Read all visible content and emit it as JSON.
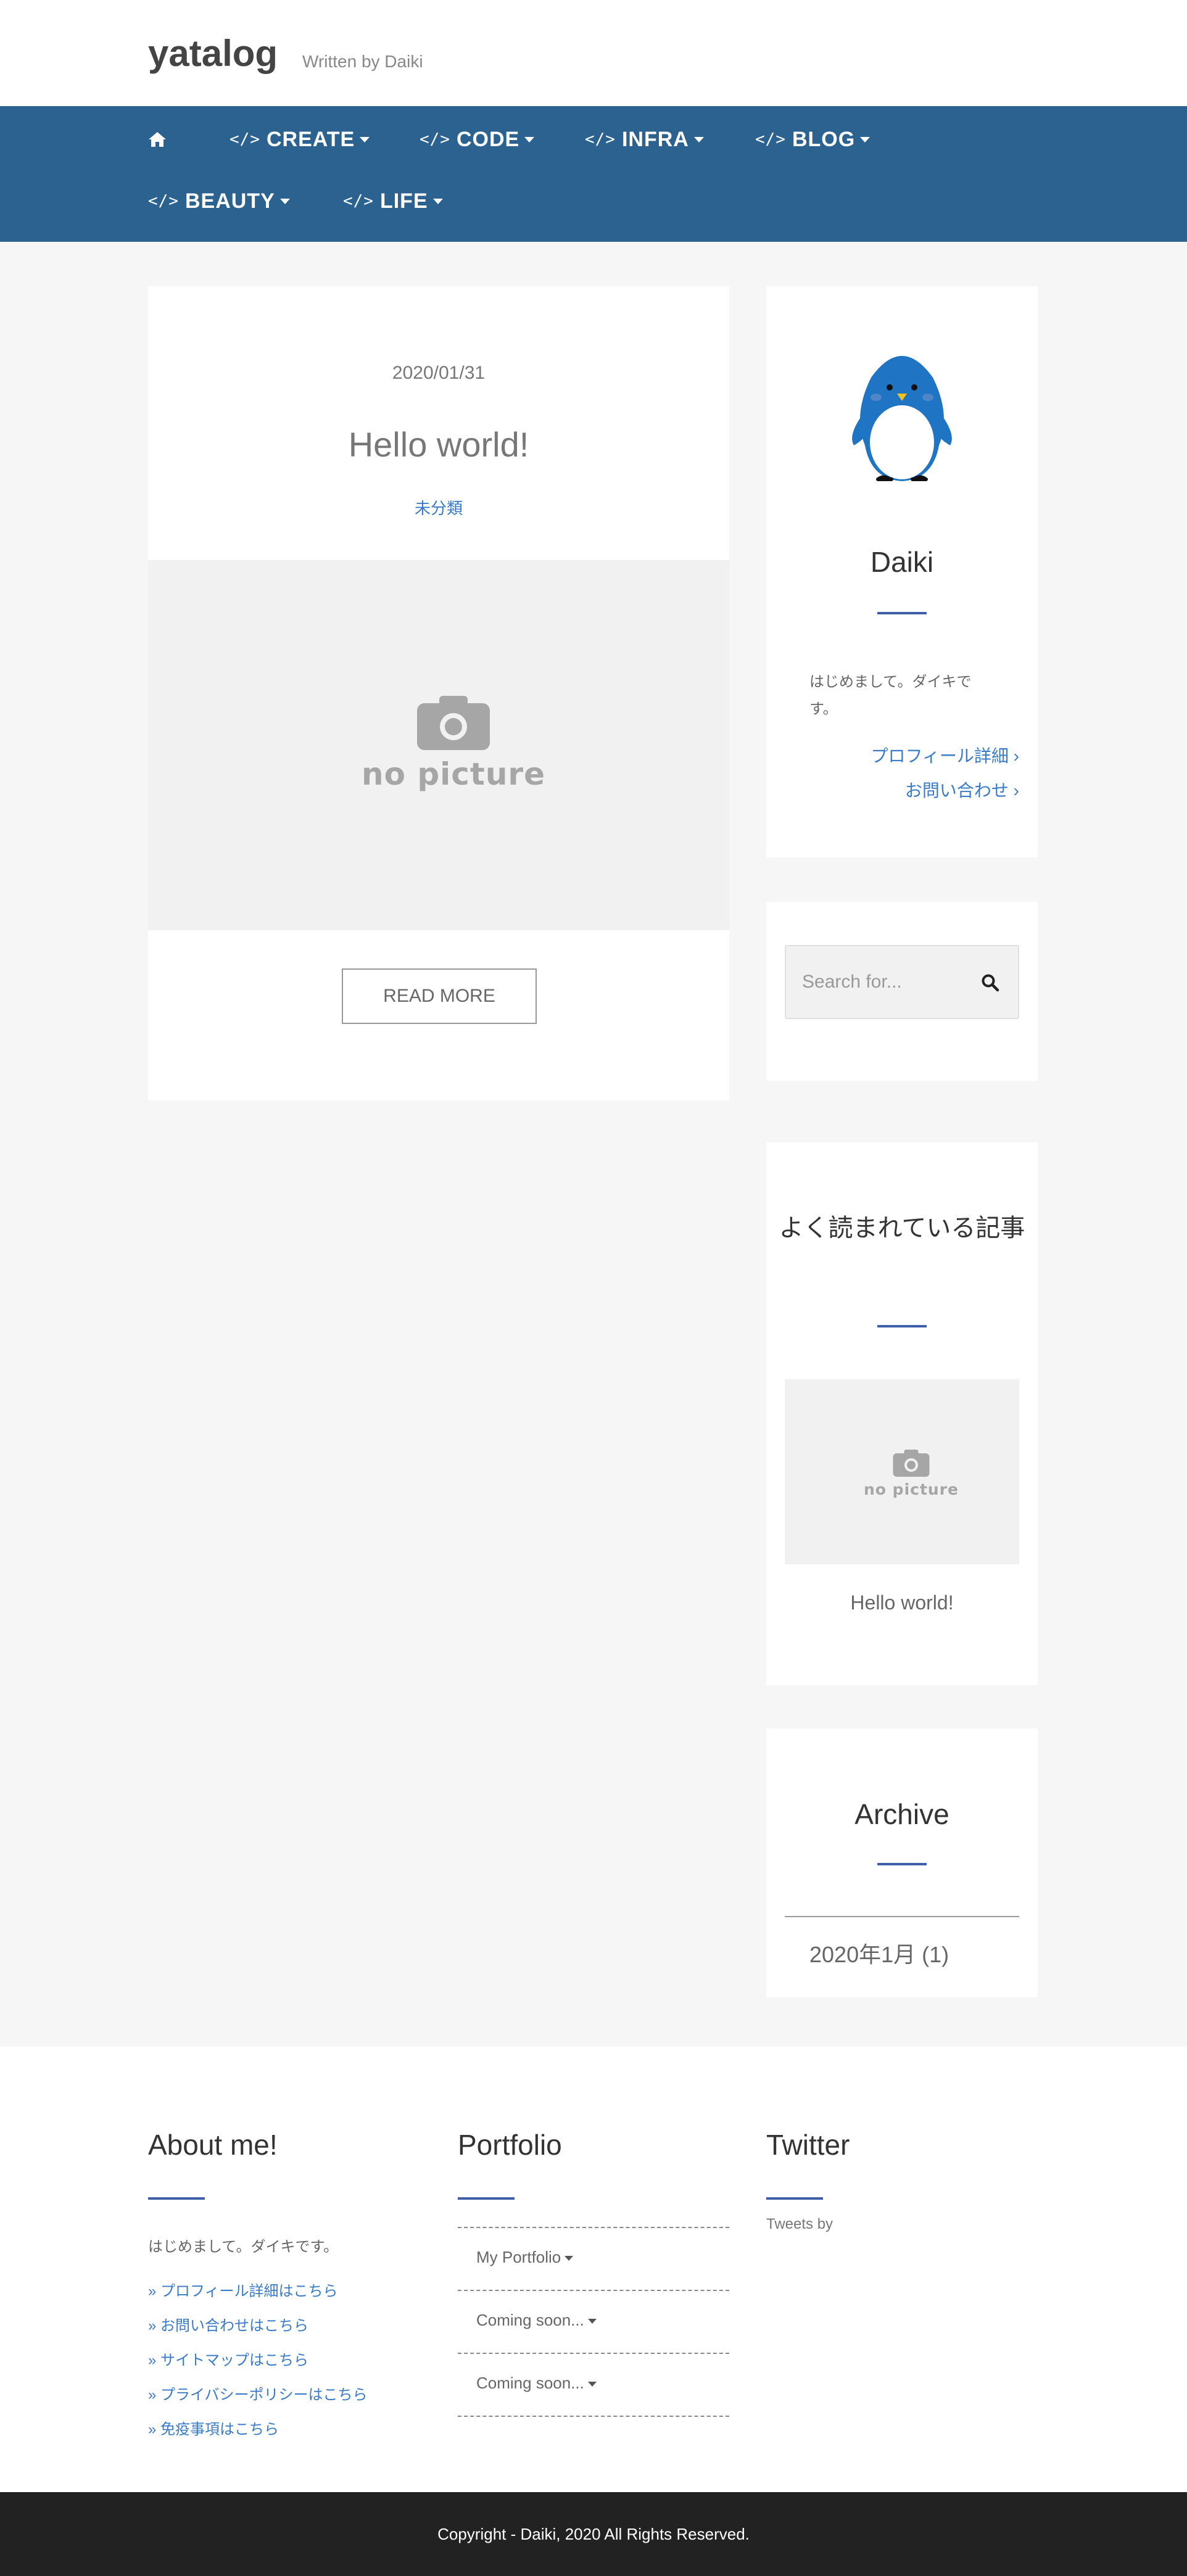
{
  "site": {
    "title": "yatalog",
    "description": "Written by Daiki"
  },
  "nav": {
    "home_icon": "home-icon",
    "items": [
      {
        "label": "CREATE"
      },
      {
        "label": "CODE"
      },
      {
        "label": "INFRA"
      },
      {
        "label": "BLOG"
      },
      {
        "label": "BEAUTY"
      },
      {
        "label": "LIFE"
      }
    ],
    "code_glyph": "</>"
  },
  "article": {
    "date": "2020/01/31",
    "title": "Hello world!",
    "category": "未分類",
    "thumbnail_text": "no picture",
    "read_more": "READ MORE"
  },
  "profile": {
    "avatar_icon": "penguin-avatar",
    "name": "Daiki",
    "intro": "はじめまして。ダイキです。",
    "links": [
      {
        "label": "プロフィール詳細"
      },
      {
        "label": "お問い合わせ"
      }
    ]
  },
  "search": {
    "placeholder": "Search for..."
  },
  "popular": {
    "title": "よく読まれている記事",
    "thumbnail_text": "no picture",
    "item_title": "Hello world!"
  },
  "archive": {
    "title": "Archive",
    "items": [
      {
        "label": "2020年1月",
        "count": "(1)"
      }
    ]
  },
  "footer": {
    "about": {
      "title": "About me!",
      "text": "はじめまして。ダイキです。",
      "links": [
        {
          "label": "» プロフィール詳細はこちら"
        },
        {
          "label": "» お問い合わせはこちら"
        },
        {
          "label": "» サイトマップはこちら"
        },
        {
          "label": "» プライバシーポリシーはこちら"
        },
        {
          "label": "» 免疫事項はこちら"
        }
      ]
    },
    "portfolio": {
      "title": "Portfolio",
      "items": [
        {
          "label": "My Portfolio"
        },
        {
          "label": "Coming soon..."
        },
        {
          "label": "Coming soon..."
        }
      ]
    },
    "twitter": {
      "title": "Twitter",
      "text": "Tweets by"
    },
    "copyright": "Copyright - Daiki, 2020 All Rights Reserved."
  },
  "colors": {
    "nav_bg": "#2b6290",
    "accent": "#3f5fa8",
    "link": "#3a7bc8",
    "footer_bg": "#222222"
  }
}
